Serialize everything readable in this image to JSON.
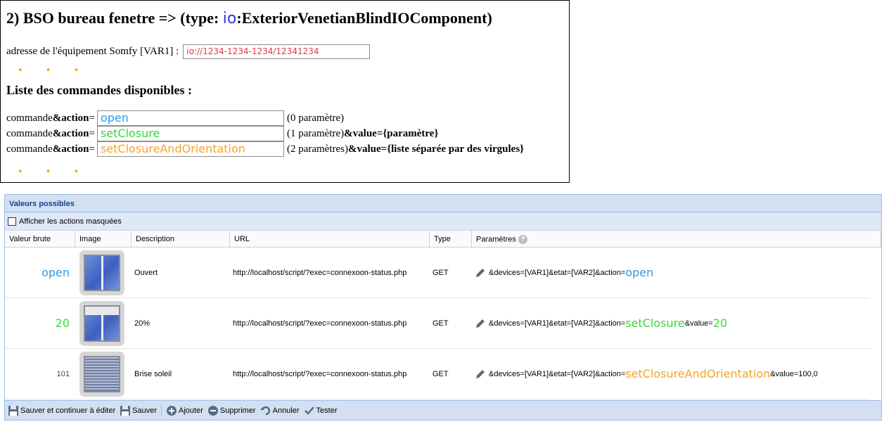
{
  "doc": {
    "title_prefix": "2) BSO bureau fenetre => (type: ",
    "title_io": "io",
    "title_suffix": ":ExteriorVenetianBlindIOComponent)",
    "address_label": "adresse de l'équipement Somfy [VAR1] :",
    "address_value": "io://1234-1234-1234/12341234",
    "dots": "• • •",
    "commands_title": "Liste des commandes disponibles :",
    "commands": [
      {
        "prefix": "commande ",
        "bold": "&action",
        "eq": " =",
        "value": "open",
        "color": "#2b9be5",
        "after": "(0 paramètre)",
        "after_bold": ""
      },
      {
        "prefix": "commande ",
        "bold": "&action",
        "eq": " =",
        "value": "setClosure",
        "color": "#39d83c",
        "after": "(1 paramètre) ",
        "after_bold": "&value={paramètre}"
      },
      {
        "prefix": "commande ",
        "bold": "&action",
        "eq": " =",
        "value": "setClosureAndOrientation",
        "color": "#f5a32a",
        "after": "(2 paramètres) ",
        "after_bold": "&value={liste séparée par des virgules}"
      }
    ]
  },
  "grid": {
    "title": "Valeurs possibles",
    "show_hidden_label": "Afficher les actions masquées",
    "columns": [
      "Valeur brute",
      "Image",
      "Description",
      "URL",
      "Type",
      "Paramètres"
    ],
    "rows": [
      {
        "raw": "open",
        "description": "Ouvert",
        "url": "http://localhost/script/?exec=connexoon-status.php",
        "type": "GET",
        "param_prefix": "&devices=[VAR1]&etat=[VAR2]&action=",
        "param_action": "open",
        "param_value_label": "",
        "param_value": ""
      },
      {
        "raw": "20",
        "description": "20%",
        "url": "http://localhost/script/?exec=connexoon-status.php",
        "type": "GET",
        "param_prefix": "&devices=[VAR1]&etat=[VAR2]&action=",
        "param_action": "setClosure",
        "param_value_label": "&value=",
        "param_value": "20"
      },
      {
        "raw": "101",
        "description": "Brise soleil",
        "url": "http://localhost/script/?exec=connexoon-status.php",
        "type": "GET",
        "param_prefix": "&devices=[VAR1]&etat=[VAR2]&action=",
        "param_action": "setClosureAndOrientation",
        "param_value_label": "&value=100,0",
        "param_value": ""
      }
    ],
    "toolbar": {
      "save_continue": "Sauver et continuer à éditer",
      "save": "Sauver",
      "add": "Ajouter",
      "delete": "Supprimer",
      "cancel": "Annuler",
      "test": "Tester"
    }
  },
  "colors": {
    "blue": "#2b9be5",
    "green": "#39d83c",
    "orange": "#f5a32a",
    "red": "#e03a3a",
    "header_blue": "#15428b"
  }
}
